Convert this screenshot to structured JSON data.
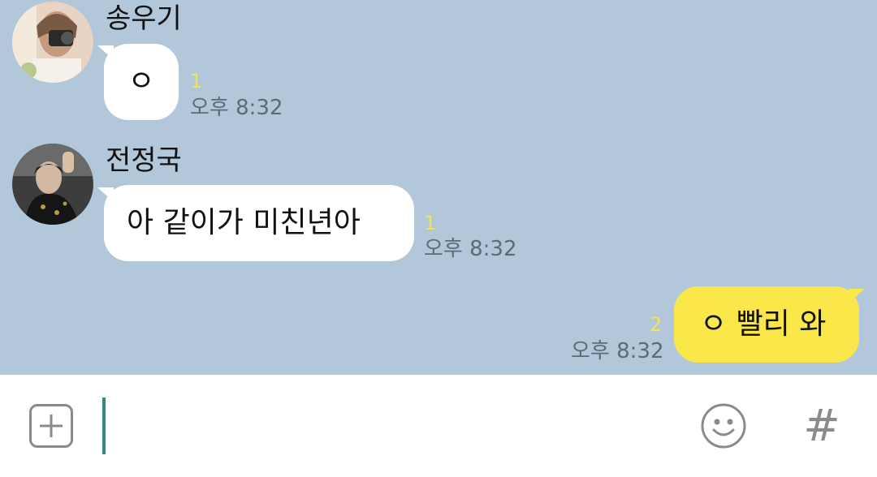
{
  "messages": [
    {
      "sender": "송우기",
      "text": "ㅇ",
      "unread": "1",
      "time": "오후 8:32"
    },
    {
      "sender": "전정국",
      "text": "아 같이가 미친년아",
      "unread": "1",
      "time": "오후 8:32"
    },
    {
      "text": "ㅇ 빨리 와",
      "unread": "2",
      "time": "오후 8:32"
    }
  ],
  "input": {
    "value": "",
    "plus_icon": "plus-square-icon",
    "emoji_icon": "smiley-icon",
    "hash_label": "#"
  },
  "colors": {
    "chat_background": "#b2c7da",
    "my_bubble": "#fae84b",
    "other_bubble": "#ffffff",
    "unread_count": "#f2e35a",
    "cursor": "#2e8c84"
  }
}
